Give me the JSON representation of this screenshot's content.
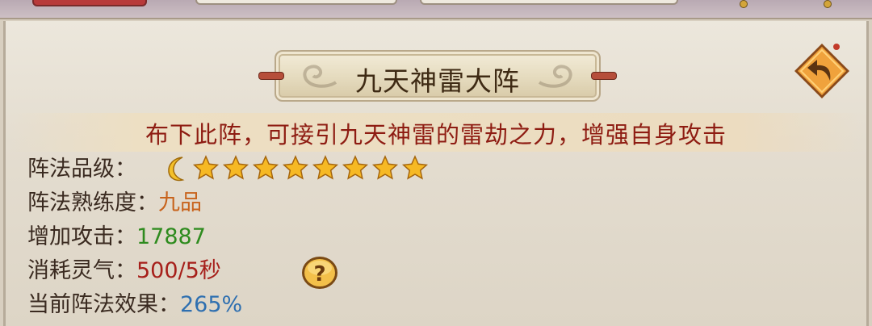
{
  "title": "九天神雷大阵",
  "description": "布下此阵，可接引九天神雷的雷劫之力，增强自身攻击",
  "stats": {
    "grade_label": "阵法品级：",
    "grade_rating": {
      "moons": 1,
      "stars": 8
    },
    "proficiency_label": "阵法熟练度：",
    "proficiency_value": "九品",
    "attack_label": "增加攻击：",
    "attack_value": "17887",
    "cost_label": "消耗灵气：",
    "cost_value": "500/5秒",
    "effect_label": "当前阵法效果：",
    "effect_value": "265%"
  },
  "icons": {
    "back": "back-arrow-icon",
    "help": "question-mark-icon",
    "moon": "crescent-moon-icon",
    "star": "star-icon"
  },
  "colors": {
    "title_text": "#3e2a14",
    "description_text": "#8e1c12",
    "proficiency": "#c8631c",
    "attack": "#2e8b1e",
    "cost": "#a61f1a",
    "effect": "#2e6fb0",
    "back_button": "#f0a23c"
  }
}
